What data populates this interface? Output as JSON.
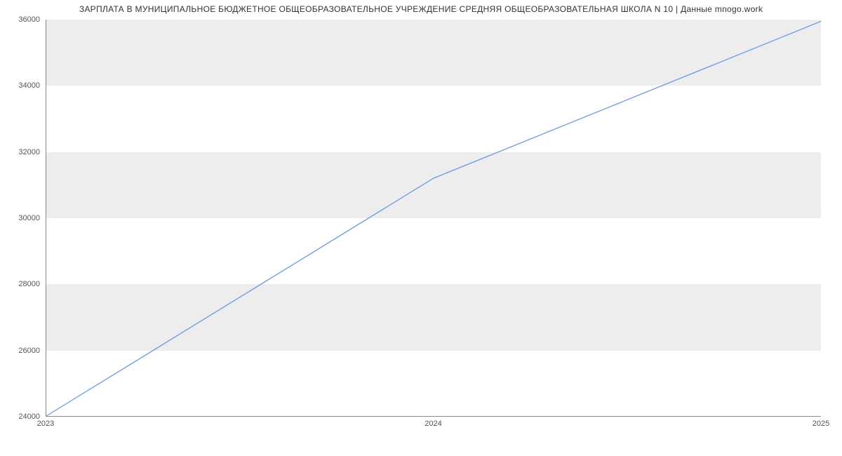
{
  "chart_data": {
    "type": "line",
    "title": "ЗАРПЛАТА В МУНИЦИПАЛЬНОЕ  БЮДЖЕТНОЕ ОБЩЕОБРАЗОВАТЕЛЬНОЕ УЧРЕЖДЕНИЕ СРЕДНЯЯ ОБЩЕОБРАЗОВАТЕЛЬНАЯ ШКОЛА N 10 | Данные mnogo.work",
    "x": [
      2023,
      2024,
      2025
    ],
    "values": [
      24000,
      31200,
      35950
    ],
    "xlabel": "",
    "ylabel": "",
    "xlim": [
      2023,
      2025
    ],
    "ylim": [
      24000,
      36000
    ],
    "x_ticks": [
      2023,
      2024,
      2025
    ],
    "y_ticks": [
      24000,
      26000,
      28000,
      30000,
      32000,
      34000,
      36000
    ],
    "line_color": "#6b9ae0",
    "band_color": "#ededed"
  }
}
